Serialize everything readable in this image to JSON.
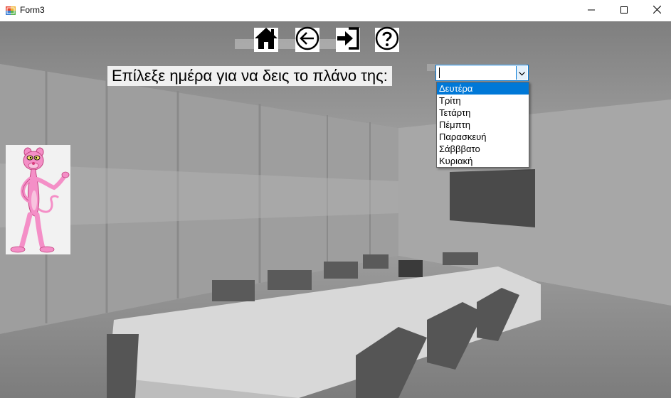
{
  "window": {
    "title": "Form3",
    "icon": "winforms-app-icon",
    "controls": [
      "minimize-icon",
      "maximize-icon",
      "close-icon"
    ]
  },
  "toolbar": {
    "buttons": [
      {
        "name": "home-button",
        "icon": "home-icon"
      },
      {
        "name": "back-button",
        "icon": "arrow-left-circle-icon"
      },
      {
        "name": "exit-button",
        "icon": "sign-in-icon"
      },
      {
        "name": "help-button",
        "icon": "question-circle-icon"
      }
    ]
  },
  "prompt": {
    "label": "Επίλεξε ημέρα για να δεις το πλάνο της:"
  },
  "day_select": {
    "value": "",
    "options": [
      "Δευτέρα",
      "Τρίτη",
      "Τετάρτη",
      "Πέμπτη",
      "Παρασκευή",
      "Σάβββατο",
      "Κυριακή"
    ],
    "highlighted_index": 0
  },
  "picture": {
    "subject": "pink-panther-illustration"
  },
  "colors": {
    "selection": "#0078d7",
    "pink": "#f48fc7"
  }
}
